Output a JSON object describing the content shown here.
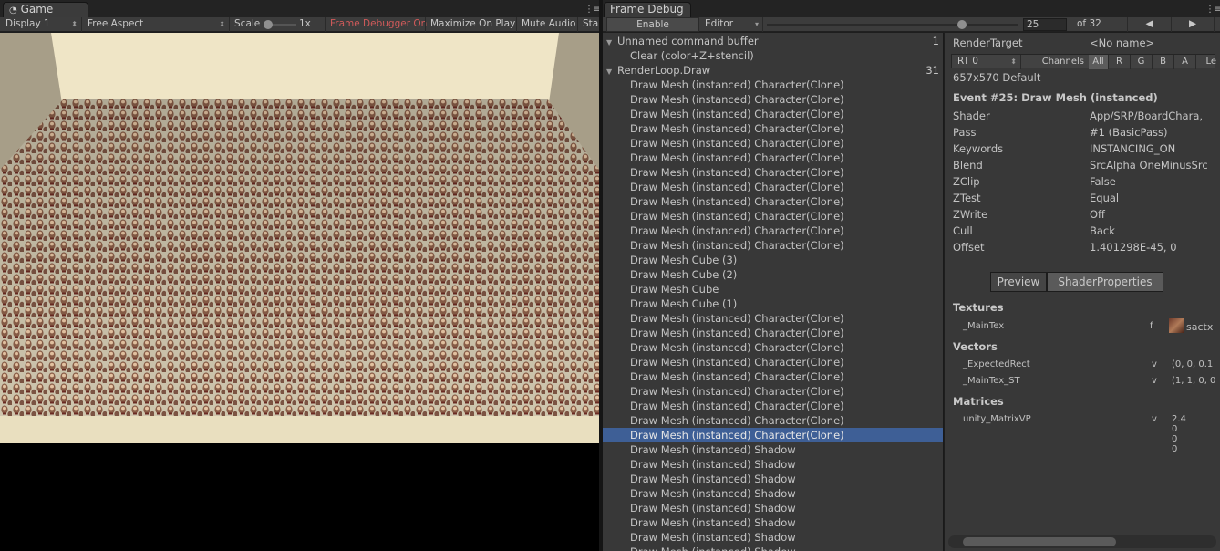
{
  "game": {
    "tab_title": "Game",
    "display": "Display 1",
    "aspect": "Free Aspect",
    "scale_label": "Scale",
    "scale_value": "1x",
    "frame_debugger": "Frame Debugger On",
    "maximize": "Maximize On Play",
    "mute": "Mute Audio",
    "stats": "Sta"
  },
  "debug": {
    "tab_title": "Frame Debug",
    "enable": "Enable",
    "target": "Editor",
    "event_index": "25",
    "event_total": "of 32",
    "slider_fraction": 0.774,
    "prev_icon": "triangle-left",
    "next_icon": "triangle-right"
  },
  "list": {
    "groups": [
      {
        "name": "Unnamed command buffer",
        "count": "1"
      },
      {
        "name": "RenderLoop.Draw",
        "count": "31"
      }
    ],
    "rows": [
      {
        "label": "Clear (color+Z+stencil)"
      },
      {
        "label": "Draw Mesh (instanced) Character(Clone)"
      },
      {
        "label": "Draw Mesh (instanced) Character(Clone)"
      },
      {
        "label": "Draw Mesh (instanced) Character(Clone)"
      },
      {
        "label": "Draw Mesh (instanced) Character(Clone)"
      },
      {
        "label": "Draw Mesh (instanced) Character(Clone)"
      },
      {
        "label": "Draw Mesh (instanced) Character(Clone)"
      },
      {
        "label": "Draw Mesh (instanced) Character(Clone)"
      },
      {
        "label": "Draw Mesh (instanced) Character(Clone)"
      },
      {
        "label": "Draw Mesh (instanced) Character(Clone)"
      },
      {
        "label": "Draw Mesh (instanced) Character(Clone)"
      },
      {
        "label": "Draw Mesh (instanced) Character(Clone)"
      },
      {
        "label": "Draw Mesh (instanced) Character(Clone)"
      },
      {
        "label": "Draw Mesh Cube (3)"
      },
      {
        "label": "Draw Mesh Cube (2)"
      },
      {
        "label": "Draw Mesh Cube"
      },
      {
        "label": "Draw Mesh Cube (1)"
      },
      {
        "label": "Draw Mesh (instanced) Character(Clone)"
      },
      {
        "label": "Draw Mesh (instanced) Character(Clone)"
      },
      {
        "label": "Draw Mesh (instanced) Character(Clone)"
      },
      {
        "label": "Draw Mesh (instanced) Character(Clone)"
      },
      {
        "label": "Draw Mesh (instanced) Character(Clone)"
      },
      {
        "label": "Draw Mesh (instanced) Character(Clone)"
      },
      {
        "label": "Draw Mesh (instanced) Character(Clone)"
      },
      {
        "label": "Draw Mesh (instanced) Character(Clone)"
      },
      {
        "label": "Draw Mesh (instanced) Character(Clone)"
      },
      {
        "label": "Draw Mesh (instanced) Shadow"
      },
      {
        "label": "Draw Mesh (instanced) Shadow"
      },
      {
        "label": "Draw Mesh (instanced) Shadow"
      },
      {
        "label": "Draw Mesh (instanced) Shadow"
      },
      {
        "label": "Draw Mesh (instanced) Shadow"
      },
      {
        "label": "Draw Mesh (instanced) Shadow"
      },
      {
        "label": "Draw Mesh (instanced) Shadow"
      },
      {
        "label": "Draw Mesh (instanced) Shadow"
      }
    ],
    "selected_row": 25
  },
  "details": {
    "render_target_label": "RenderTarget",
    "render_target_value": "<No name>",
    "rt": "RT 0",
    "channels_label": "Channels",
    "channels": [
      "All",
      "R",
      "G",
      "B",
      "A"
    ],
    "levels": "Le",
    "resolution": "657x570 Default",
    "event_title": "Event #25: Draw Mesh (instanced)",
    "fields": [
      {
        "k": "Shader",
        "v": "App/SRP/BoardChara,"
      },
      {
        "k": "Pass",
        "v": "#1 (BasicPass)"
      },
      {
        "k": "Keywords",
        "v": "INSTANCING_ON"
      },
      {
        "k": "Blend",
        "v": "SrcAlpha OneMinusSrc"
      },
      {
        "k": "ZClip",
        "v": "False"
      },
      {
        "k": "ZTest",
        "v": "Equal"
      },
      {
        "k": "ZWrite",
        "v": "Off"
      },
      {
        "k": "Cull",
        "v": "Back"
      },
      {
        "k": "Offset",
        "v": "1.401298E-45, 0"
      }
    ],
    "tab_preview": "Preview",
    "tab_shader_props": "ShaderProperties",
    "textures_label": "Textures",
    "texture": {
      "name": "_MainTex",
      "stage": "f",
      "value": "sactx"
    },
    "vectors_label": "Vectors",
    "vectors": [
      {
        "name": "_ExpectedRect",
        "stage": "v",
        "value": "(0, 0, 0.1"
      },
      {
        "name": "_MainTex_ST",
        "stage": "v",
        "value": "(1, 1, 0, 0"
      }
    ],
    "matrices_label": "Matrices",
    "matrix": {
      "name": "unity_MatrixVP",
      "stage": "v",
      "values": [
        "2.4",
        "0",
        "0",
        "0"
      ]
    }
  },
  "colors": {
    "selection": "#3e5f96",
    "frame_debugger_text": "#d05a5a",
    "floor": "#cfc6ae",
    "back_wall": "#efe5c6"
  }
}
